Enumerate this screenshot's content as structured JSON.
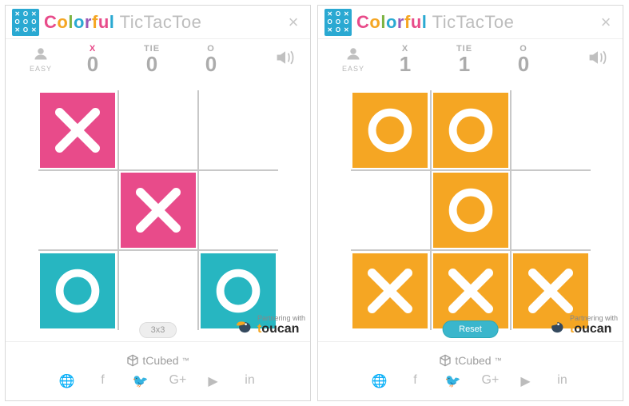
{
  "app": {
    "title_colorful": "Colorful",
    "title_rest": " TicTacToe",
    "close": "×"
  },
  "difficulty": {
    "label": "EASY"
  },
  "sound_icon": "speaker-icon",
  "footer": {
    "brand": "tCubed",
    "tm": "™",
    "social": [
      "globe",
      "facebook",
      "twitter",
      "googleplus",
      "youtube",
      "linkedin"
    ]
  },
  "partner": {
    "line1": "Partnering with",
    "brand": "toucan"
  },
  "panels": [
    {
      "scores": {
        "x_label": "X",
        "tie_label": "TIE",
        "o_label": "O",
        "x": "0",
        "tie": "0",
        "o": "0",
        "active": "x"
      },
      "bottom_button": {
        "label": "3x3",
        "style": "gray"
      },
      "board": [
        {
          "mark": "X",
          "style": "pink-x"
        },
        {
          "mark": "",
          "style": ""
        },
        {
          "mark": "",
          "style": ""
        },
        {
          "mark": "",
          "style": ""
        },
        {
          "mark": "X",
          "style": "pink-x"
        },
        {
          "mark": "",
          "style": ""
        },
        {
          "mark": "O",
          "style": "teal-o"
        },
        {
          "mark": "",
          "style": ""
        },
        {
          "mark": "O",
          "style": "teal-o"
        }
      ]
    },
    {
      "scores": {
        "x_label": "X",
        "tie_label": "TIE",
        "o_label": "O",
        "x": "1",
        "tie": "1",
        "o": "0",
        "active": ""
      },
      "bottom_button": {
        "label": "Reset",
        "style": "reset"
      },
      "board": [
        {
          "mark": "O",
          "style": "orange"
        },
        {
          "mark": "O",
          "style": "orange"
        },
        {
          "mark": "",
          "style": ""
        },
        {
          "mark": "",
          "style": ""
        },
        {
          "mark": "O",
          "style": "orange"
        },
        {
          "mark": "",
          "style": ""
        },
        {
          "mark": "X",
          "style": "orange"
        },
        {
          "mark": "X",
          "style": "orange"
        },
        {
          "mark": "X",
          "style": "orange"
        }
      ]
    }
  ]
}
